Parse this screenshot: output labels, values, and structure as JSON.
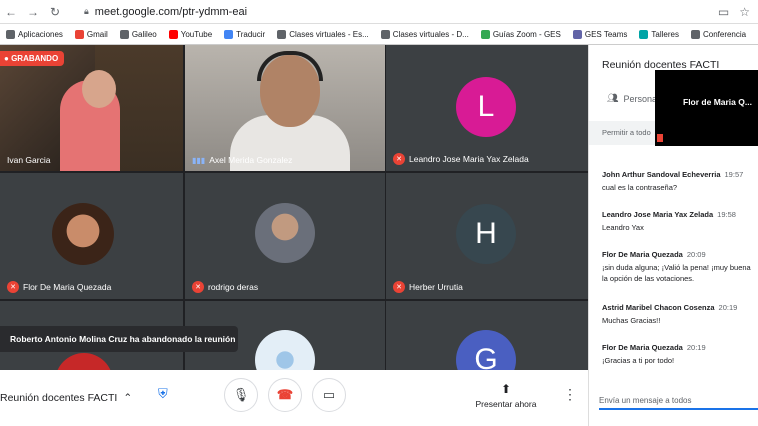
{
  "browser": {
    "url": "meet.google.com/ptr-ydmm-eai",
    "bookmarks": [
      {
        "label": "Aplicaciones",
        "color": "#5f6368"
      },
      {
        "label": "Gmail",
        "color": "#ea4335"
      },
      {
        "label": "Galileo",
        "color": "#5f6368"
      },
      {
        "label": "YouTube",
        "color": "#ff0000"
      },
      {
        "label": "Traducir",
        "color": "#4285f4"
      },
      {
        "label": "Clases virtuales - Es...",
        "color": "#5f6368"
      },
      {
        "label": "Clases virtuales - D...",
        "color": "#5f6368"
      },
      {
        "label": "Guías Zoom - GES",
        "color": "#34a853"
      },
      {
        "label": "GES Teams",
        "color": "#6264a7"
      },
      {
        "label": "Talleres",
        "color": "#00a4a6"
      },
      {
        "label": "Conferencia",
        "color": "#5f6368"
      }
    ]
  },
  "recording_label": "GRABANDO",
  "participants": [
    {
      "name": "Ivan Garcia",
      "mic": "on"
    },
    {
      "name": "Axel Merida Gonzalez",
      "mic": "speaking"
    },
    {
      "name": "Leandro Jose Maria Yax Zelada",
      "mic": "off",
      "initial": "L",
      "color": "#d81b95"
    },
    {
      "name": "Flor De Maria Quezada",
      "mic": "off"
    },
    {
      "name": "rodrigo deras",
      "mic": "off"
    },
    {
      "name": "Herber Urrutia",
      "mic": "off",
      "initial": "H",
      "color": "#37474f"
    },
    {
      "name": "",
      "mic": "",
      "initial": "G",
      "color": "#4a5fc1"
    }
  ],
  "toast": "Roberto Antonio Molina Cruz ha abandonado la reunión",
  "bottom_bar": {
    "meeting_name": "Reunión docentes FACTI",
    "present_label": "Presentar ahora"
  },
  "panel": {
    "title": "Reunión docentes FACTI",
    "people_tab": "Persona",
    "allow_text": "Permitir a todo",
    "messages": [
      {
        "sender": "John Arthur Sandoval Echeverria",
        "time": "19:57",
        "text": "cual es la contraseña?"
      },
      {
        "sender": "Leandro Jose Maria Yax Zelada",
        "time": "19:58",
        "text": "Leandro Yax"
      },
      {
        "sender": "Flor De Maria Quezada",
        "time": "20:09",
        "text": "¡sin duda alguna; ¡Valió la pena! ¡muy buena la opción de las votaciones."
      },
      {
        "sender": "Astrid Maribel Chacon Cosenza",
        "time": "20:19",
        "text": "Muchas Gracias!!"
      },
      {
        "sender": "Flor De Maria Quezada",
        "time": "20:19",
        "text": "¡Gracias a ti por todo!"
      }
    ],
    "composer_placeholder": "Envía un mensaje a todos"
  },
  "pip_label": "Flor de Maria Q..."
}
